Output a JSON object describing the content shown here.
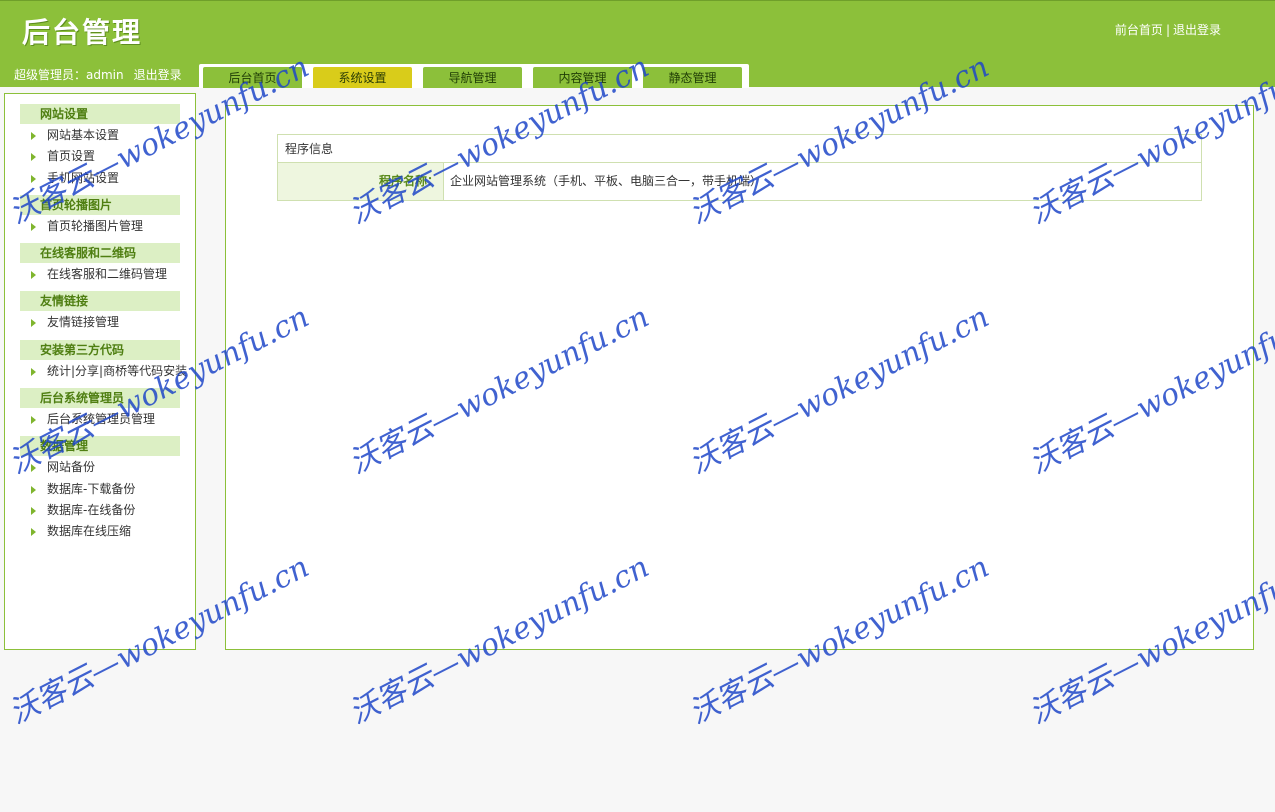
{
  "header": {
    "logo": "后台管理",
    "links": {
      "home": "前台首页",
      "separator": "|",
      "logout": "退出登录"
    }
  },
  "user_bar": {
    "user": "超级管理员：admin",
    "logout": "退出登录"
  },
  "tabs": [
    {
      "label": "后台首页",
      "active": false
    },
    {
      "label": "系统设置",
      "active": true
    },
    {
      "label": "导航管理",
      "active": false
    },
    {
      "label": "内容管理",
      "active": false
    },
    {
      "label": "静态管理",
      "active": false
    }
  ],
  "sidebar": {
    "groups": [
      {
        "title": "网站设置",
        "items": [
          "网站基本设置",
          "首页设置",
          "手机网站设置"
        ]
      },
      {
        "title": "首页轮播图片",
        "items": [
          "首页轮播图片管理"
        ]
      },
      {
        "title": "在线客服和二维码",
        "items": [
          "在线客服和二维码管理"
        ]
      },
      {
        "title": "友情链接",
        "items": [
          "友情链接管理"
        ]
      },
      {
        "title": "安装第三方代码",
        "items": [
          "统计|分享|商桥等代码安装"
        ]
      },
      {
        "title": "后台系统管理员",
        "items": [
          "后台系统管理员管理"
        ]
      },
      {
        "title": "数据管理",
        "items": [
          "网站备份",
          "数据库-下载备份",
          "数据库-在线备份",
          "数据库在线压缩"
        ]
      }
    ]
  },
  "main": {
    "caption": "程序信息",
    "rows": [
      {
        "label": "程序名称：",
        "value": "企业网站管理系统（手机、平板、电脑三合一，带手机端）"
      }
    ]
  },
  "watermark": {
    "text": "沃客云—wokeyunfu.cn",
    "color": "#1e46c8"
  },
  "colors": {
    "brand_green": "#8cc03a",
    "active_tab": "#d9cc1a",
    "group_bg": "#dcefc4"
  }
}
